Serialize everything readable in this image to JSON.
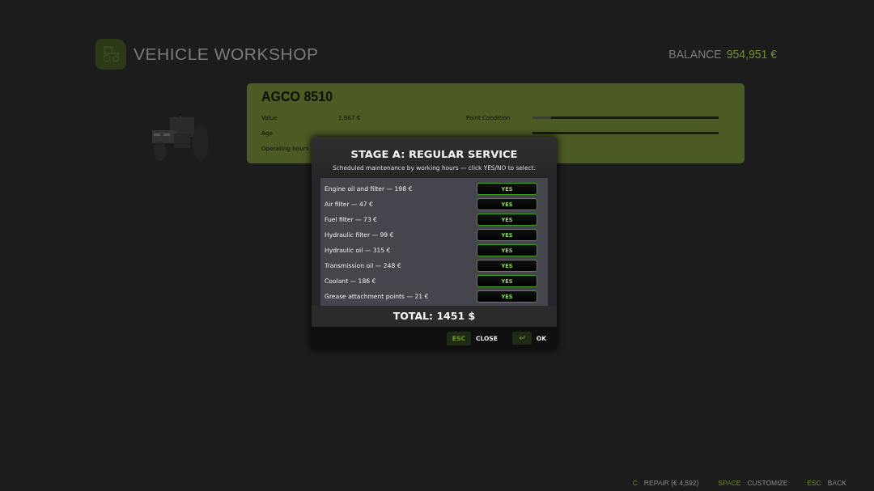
{
  "header": {
    "title": "VEHICLE WORKSHOP",
    "balance_label": "BALANCE",
    "balance_value": "954,951 €"
  },
  "vehicle": {
    "name": "AGCO 8510",
    "kind": "picture",
    "stats": [
      {
        "label": "Value",
        "value": "1,967 €"
      },
      {
        "label": "Age"
      },
      {
        "label": "Operating hours"
      }
    ],
    "paint": {
      "label": "Paint Condition",
      "level": 0.1
    }
  },
  "dialog": {
    "title": "STAGE A: REGULAR SERVICE",
    "subtitle": "Scheduled maintenance by working hours — click YES/NO to select:",
    "items": [
      {
        "label": "Engine oil and filter — 198 €",
        "choice": "YES",
        "selected": true
      },
      {
        "label": "Air filter — 47 €",
        "choice": "YES",
        "selected": true
      },
      {
        "label": "Fuel filter — 73 €",
        "choice": "YES",
        "selected": true
      },
      {
        "label": "Hydraulic filter — 99 €",
        "choice": "YES",
        "selected": true
      },
      {
        "label": "Hydraulic oil — 315 €",
        "choice": "YES",
        "selected": true
      },
      {
        "label": "Transmission oil — 248 €",
        "choice": "YES",
        "selected": true
      },
      {
        "label": "Coolant — 186 €",
        "choice": "YES",
        "selected": true
      },
      {
        "label": "Grease attachment points — 21 €",
        "choice": "YES",
        "selected": true
      }
    ],
    "total": "TOTAL: 1451 $",
    "actions": [
      {
        "key": "ESC",
        "label": "CLOSE",
        "kind": "text"
      },
      {
        "label": "OK",
        "kind": "enter"
      }
    ]
  },
  "footer": [
    {
      "key": "C",
      "label": "REPAIR (€ 4,592)"
    },
    {
      "key": "SPACE",
      "label": "CUSTOMIZE"
    },
    {
      "key": "ESC",
      "label": "BACK"
    }
  ]
}
